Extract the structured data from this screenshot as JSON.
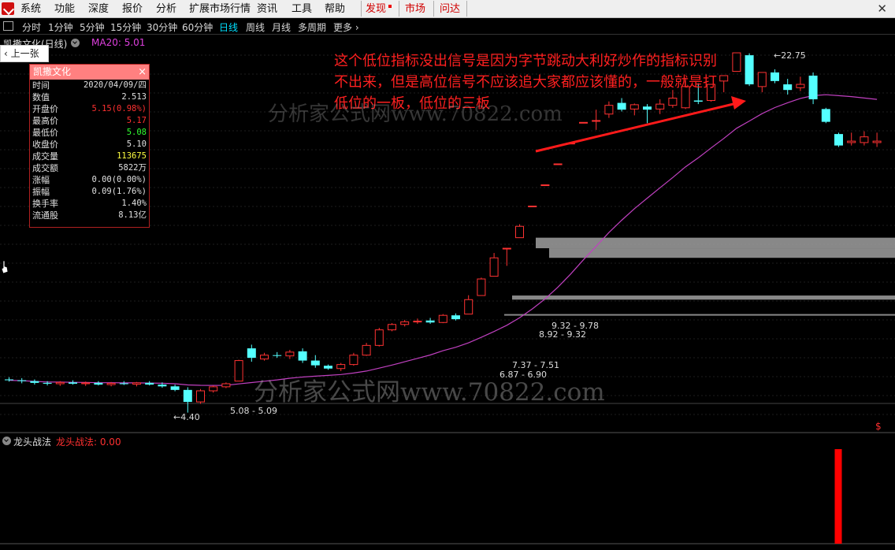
{
  "menu": {
    "items": [
      "系统",
      "功能",
      "深度",
      "报价",
      "分析",
      "扩展市场行情",
      "资讯",
      "工具",
      "帮助"
    ],
    "highlight_items": [
      "发现",
      "市场",
      "问达"
    ]
  },
  "periods": {
    "tabs": [
      "分时",
      "1分钟",
      "5分钟",
      "15分钟",
      "30分钟",
      "60分钟",
      "日线",
      "周线",
      "月线",
      "多周期",
      "更多"
    ],
    "active": "日线"
  },
  "chart_header": {
    "stock_label": "凯撒文化(日线)",
    "ma_label": "MA20: 5.01"
  },
  "prev_button": "上一张",
  "info_panel": {
    "title": "凯撒文化",
    "close": "×",
    "rows": [
      {
        "label": "时间",
        "value": "2020/04/09/四",
        "color": "white"
      },
      {
        "label": "数值",
        "value": "2.513",
        "color": "white"
      },
      {
        "label": "开盘价",
        "value": "5.15(0.98%)",
        "color": "red"
      },
      {
        "label": "最高价",
        "value": "5.17",
        "color": "red"
      },
      {
        "label": "最低价",
        "value": "5.08",
        "color": "green"
      },
      {
        "label": "收盘价",
        "value": "5.10",
        "color": "white"
      },
      {
        "label": "成交量",
        "value": "113675",
        "color": "yellow"
      },
      {
        "label": "成交额",
        "value": "5822万",
        "color": "white"
      },
      {
        "label": "涨幅",
        "value": "0.00(0.00%)",
        "color": "white"
      },
      {
        "label": "振幅",
        "value": "0.09(1.76%)",
        "color": "white"
      },
      {
        "label": "换手率",
        "value": "1.40%",
        "color": "white"
      },
      {
        "label": "流通股",
        "value": "8.13亿",
        "color": "white"
      }
    ]
  },
  "annotation": "这个低位指标没出信号是因为字节跳动大利好炒作的指标识别不出来，但是高位信号不应该追大家都应该懂的，一般就是打低位的一板，低位的三板",
  "watermarks": [
    "分析家公式网www.70822.com",
    "分析家公式网www.70822.com"
  ],
  "price_labels": {
    "high": "22.75",
    "low": "4.40",
    "gap1": "5.08 - 5.09",
    "gap2": "6.87 - 6.90",
    "gap3": "7.37 - 7.51",
    "gap4": "8.92 - 9.32",
    "gap5": "9.32 - 9.78"
  },
  "indicator": {
    "name": "龙头战法",
    "value_label": "龙头战法: 0.00",
    "signal_count": 1
  },
  "dollar_icon": "$",
  "colors": {
    "up": "#ff3232",
    "down": "#54ffff",
    "ma": "#c040c0",
    "signal": "#ff0000",
    "gap_band": "#a0a0a0"
  },
  "chart_data": {
    "type": "candlestick",
    "period": "日线",
    "price_range": [
      4.3,
      23.0
    ],
    "candles": [
      {
        "o": 5.12,
        "h": 5.17,
        "l": 5.07,
        "c": 5.1
      },
      {
        "o": 5.1,
        "h": 5.15,
        "l": 5.03,
        "c": 5.08
      },
      {
        "o": 5.08,
        "h": 5.12,
        "l": 5.0,
        "c": 5.04
      },
      {
        "o": 5.04,
        "h": 5.08,
        "l": 4.98,
        "c": 5.02
      },
      {
        "o": 5.02,
        "h": 5.08,
        "l": 4.97,
        "c": 5.05
      },
      {
        "o": 5.05,
        "h": 5.1,
        "l": 5.0,
        "c": 5.02
      },
      {
        "o": 5.02,
        "h": 5.07,
        "l": 4.97,
        "c": 5.04
      },
      {
        "o": 5.04,
        "h": 5.08,
        "l": 4.98,
        "c": 5.0
      },
      {
        "o": 5.0,
        "h": 5.06,
        "l": 4.96,
        "c": 5.03
      },
      {
        "o": 5.03,
        "h": 5.08,
        "l": 4.99,
        "c": 5.01
      },
      {
        "o": 5.01,
        "h": 5.06,
        "l": 4.96,
        "c": 5.04
      },
      {
        "o": 5.04,
        "h": 5.08,
        "l": 4.98,
        "c": 5.0
      },
      {
        "o": 5.0,
        "h": 5.05,
        "l": 4.93,
        "c": 4.96
      },
      {
        "o": 4.96,
        "h": 5.0,
        "l": 4.85,
        "c": 4.88
      },
      {
        "o": 4.88,
        "h": 4.94,
        "l": 4.4,
        "c": 4.62
      },
      {
        "o": 4.62,
        "h": 4.9,
        "l": 4.58,
        "c": 4.86
      },
      {
        "o": 4.86,
        "h": 4.98,
        "l": 4.82,
        "c": 4.95
      },
      {
        "o": 4.95,
        "h": 5.05,
        "l": 4.92,
        "c": 5.02
      },
      {
        "o": 5.08,
        "h": 5.6,
        "l": 5.08,
        "c": 5.58
      },
      {
        "o": 5.9,
        "h": 6.0,
        "l": 5.55,
        "c": 5.65
      },
      {
        "o": 5.62,
        "h": 5.78,
        "l": 5.58,
        "c": 5.72
      },
      {
        "o": 5.72,
        "h": 5.8,
        "l": 5.65,
        "c": 5.7
      },
      {
        "o": 5.7,
        "h": 5.86,
        "l": 5.62,
        "c": 5.8
      },
      {
        "o": 5.82,
        "h": 5.9,
        "l": 5.52,
        "c": 5.58
      },
      {
        "o": 5.58,
        "h": 5.72,
        "l": 5.4,
        "c": 5.46
      },
      {
        "o": 5.45,
        "h": 5.48,
        "l": 5.35,
        "c": 5.38
      },
      {
        "o": 5.38,
        "h": 5.52,
        "l": 5.32,
        "c": 5.48
      },
      {
        "o": 5.48,
        "h": 5.78,
        "l": 5.45,
        "c": 5.72
      },
      {
        "o": 5.72,
        "h": 6.05,
        "l": 5.7,
        "c": 5.98
      },
      {
        "o": 5.98,
        "h": 6.48,
        "l": 5.95,
        "c": 6.42
      },
      {
        "o": 6.42,
        "h": 6.62,
        "l": 6.38,
        "c": 6.58
      },
      {
        "o": 6.58,
        "h": 6.72,
        "l": 6.52,
        "c": 6.66
      },
      {
        "o": 6.66,
        "h": 6.76,
        "l": 6.6,
        "c": 6.68
      },
      {
        "o": 6.7,
        "h": 6.78,
        "l": 6.6,
        "c": 6.64
      },
      {
        "o": 6.64,
        "h": 6.9,
        "l": 6.62,
        "c": 6.86
      },
      {
        "o": 6.86,
        "h": 6.92,
        "l": 6.7,
        "c": 6.74
      },
      {
        "o": 6.9,
        "h": 7.52,
        "l": 6.9,
        "c": 7.37
      },
      {
        "o": 7.51,
        "h": 8.15,
        "l": 7.51,
        "c": 8.1
      },
      {
        "o": 8.2,
        "h": 9.12,
        "l": 8.2,
        "c": 8.92
      },
      {
        "o": 9.32,
        "h": 9.32,
        "l": 8.6,
        "c": 9.32
      },
      {
        "o": 9.78,
        "h": 10.4,
        "l": 9.78,
        "c": 10.3
      },
      {
        "o": 11.3,
        "h": 11.3,
        "l": 11.3,
        "c": 11.3
      },
      {
        "o": 12.45,
        "h": 12.45,
        "l": 12.45,
        "c": 12.45
      },
      {
        "o": 13.7,
        "h": 13.7,
        "l": 13.7,
        "c": 13.7
      },
      {
        "o": 15.06,
        "h": 15.06,
        "l": 15.06,
        "c": 15.06
      },
      {
        "o": 16.56,
        "h": 16.56,
        "l": 16.56,
        "c": 16.56
      },
      {
        "o": 16.7,
        "h": 17.55,
        "l": 16.0,
        "c": 16.7
      },
      {
        "o": 17.2,
        "h": 18.22,
        "l": 16.9,
        "c": 17.9
      },
      {
        "o": 18.1,
        "h": 18.5,
        "l": 17.4,
        "c": 17.55
      },
      {
        "o": 17.6,
        "h": 18.05,
        "l": 17.1,
        "c": 17.95
      },
      {
        "o": 17.8,
        "h": 18.0,
        "l": 16.5,
        "c": 17.55
      },
      {
        "o": 17.6,
        "h": 18.4,
        "l": 17.2,
        "c": 18.0
      },
      {
        "o": 17.9,
        "h": 19.2,
        "l": 17.7,
        "c": 18.5
      },
      {
        "o": 17.7,
        "h": 20.3,
        "l": 17.6,
        "c": 19.5
      },
      {
        "o": 18.3,
        "h": 19.8,
        "l": 18.0,
        "c": 18.2
      },
      {
        "o": 18.3,
        "h": 19.6,
        "l": 18.2,
        "c": 19.7
      },
      {
        "o": 20.0,
        "h": 20.0,
        "l": 19.0,
        "c": 20.5
      },
      {
        "o": 20.9,
        "h": 22.75,
        "l": 20.9,
        "c": 22.75
      },
      {
        "o": 22.5,
        "h": 22.7,
        "l": 19.55,
        "c": 19.7
      },
      {
        "o": 19.5,
        "h": 20.8,
        "l": 19.0,
        "c": 20.8
      },
      {
        "o": 20.8,
        "h": 21.1,
        "l": 19.8,
        "c": 20.0
      },
      {
        "o": 19.7,
        "h": 20.2,
        "l": 18.8,
        "c": 19.2
      },
      {
        "o": 19.4,
        "h": 20.4,
        "l": 19.1,
        "c": 19.7
      },
      {
        "o": 20.5,
        "h": 20.8,
        "l": 18.0,
        "c": 18.4
      },
      {
        "o": 17.6,
        "h": 17.7,
        "l": 16.5,
        "c": 16.6
      },
      {
        "o": 15.7,
        "h": 15.8,
        "l": 14.8,
        "c": 14.9
      },
      {
        "o": 15.1,
        "h": 15.8,
        "l": 14.9,
        "c": 15.2
      },
      {
        "o": 15.1,
        "h": 15.9,
        "l": 14.9,
        "c": 15.5
      },
      {
        "o": 15.1,
        "h": 15.8,
        "l": 14.8,
        "c": 15.2
      }
    ],
    "gap_bands": [
      {
        "lo": 9.32,
        "hi": 9.78
      },
      {
        "lo": 8.92,
        "hi": 9.32
      },
      {
        "lo": 7.37,
        "hi": 7.51
      },
      {
        "lo": 6.87,
        "hi": 6.9
      }
    ],
    "indicator_signals": [
      {
        "index": 65,
        "value": 1
      }
    ]
  }
}
